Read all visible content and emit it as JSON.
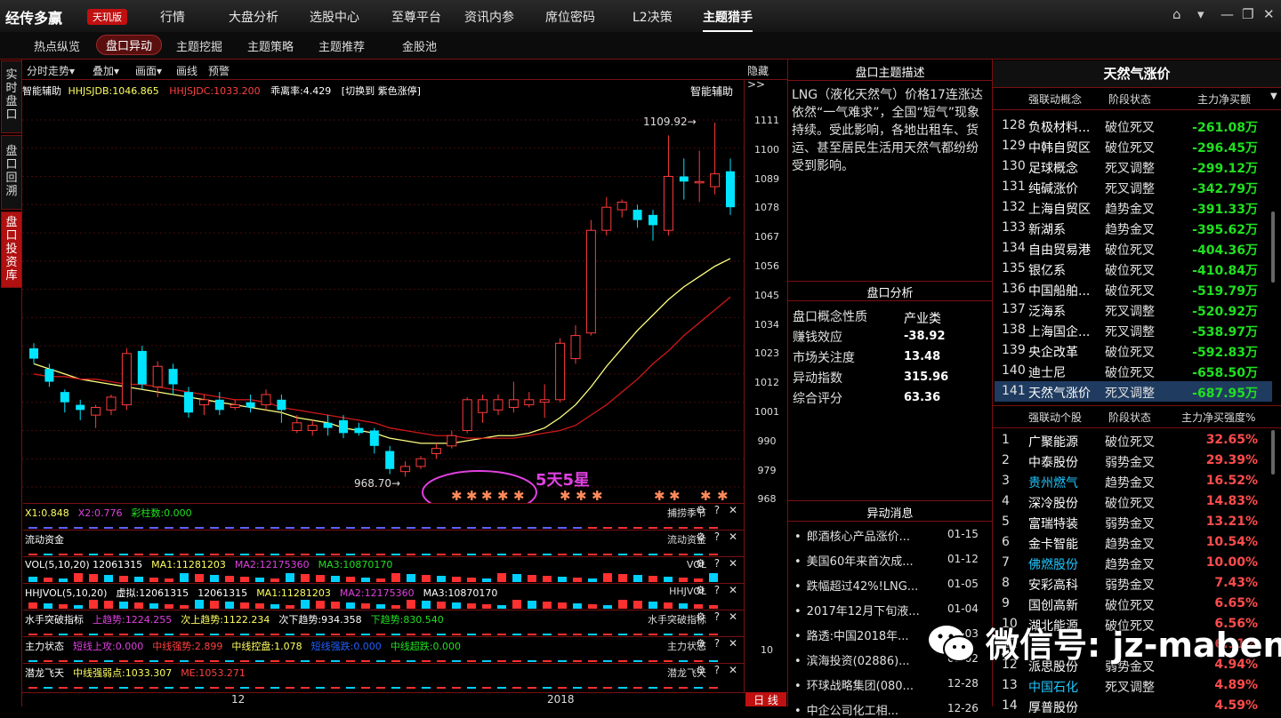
{
  "app": {
    "logo": "经传多赢",
    "edition": "天玑版"
  },
  "menu": [
    "行情",
    "大盘分析",
    "选股中心",
    "至尊平台",
    "资讯内参",
    "席位密码",
    "L2决策",
    "主题猎手"
  ],
  "menu_active": "主题猎手",
  "window_controls": [
    "⌂",
    "▾",
    "—",
    "❐",
    "✕"
  ],
  "subtabs": [
    "热点纵览",
    "盘口异动",
    "主题挖掘",
    "主题策略",
    "主题推荐",
    "金股池"
  ],
  "subtab_active": "盘口异动",
  "left_tabs": [
    {
      "label": "实时盘口"
    },
    {
      "label": "盘口回溯"
    },
    {
      "label": "盘口投资库"
    }
  ],
  "toolbar": {
    "items": [
      "分时走势▾",
      "叠加▾",
      "画面▾",
      "画线",
      "预警"
    ],
    "hide": "隐藏>>"
  },
  "chart": {
    "header_left": "智能辅助",
    "hhjsjdb": "HHJSJDB:1046.865",
    "hhjsjdc": "HHJSJDC:1033.200",
    "deviation": "乖离率:4.429",
    "switch": "[切换到 紫色涨停]",
    "header_right": "智能辅助",
    "high_label": "1109.92→",
    "low_label": "968.70→",
    "annotation": "5天5星",
    "x_labels": [
      "12",
      "2018"
    ],
    "period": "日 线",
    "y_ticks": [
      "1111",
      "1100",
      "1089",
      "1078",
      "1067",
      "1056",
      "1045",
      "1034",
      "1023",
      "1012",
      "1001",
      "990",
      "979",
      "968"
    ]
  },
  "chart_data": {
    "type": "candlestick",
    "ylim": [
      968,
      1111
    ],
    "candles": [
      {
        "o": 1022,
        "c": 1018,
        "h": 1024,
        "l": 1016
      },
      {
        "o": 1014,
        "c": 1009,
        "h": 1016,
        "l": 1007
      },
      {
        "o": 1005,
        "c": 1001,
        "h": 1006,
        "l": 997
      },
      {
        "o": 1000,
        "c": 998,
        "h": 1002,
        "l": 994
      },
      {
        "o": 996,
        "c": 999,
        "h": 1000,
        "l": 991
      },
      {
        "o": 998,
        "c": 1003,
        "h": 1004,
        "l": 996
      },
      {
        "o": 1000,
        "c": 1020,
        "h": 1022,
        "l": 998
      },
      {
        "o": 1021,
        "c": 1008,
        "h": 1023,
        "l": 1006
      },
      {
        "o": 1007,
        "c": 1015,
        "h": 1017,
        "l": 1003
      },
      {
        "o": 1014,
        "c": 1008,
        "h": 1016,
        "l": 1004
      },
      {
        "o": 1005,
        "c": 997,
        "h": 1007,
        "l": 995
      },
      {
        "o": 1000,
        "c": 1002,
        "h": 1004,
        "l": 996
      },
      {
        "o": 1002,
        "c": 998,
        "h": 1005,
        "l": 996
      },
      {
        "o": 999,
        "c": 1000,
        "h": 1002,
        "l": 998
      },
      {
        "o": 1001,
        "c": 999,
        "h": 1004,
        "l": 997
      },
      {
        "o": 1000,
        "c": 1004,
        "h": 1006,
        "l": 998
      },
      {
        "o": 1002,
        "c": 998,
        "h": 1004,
        "l": 993
      },
      {
        "o": 990,
        "c": 993,
        "h": 996,
        "l": 989
      },
      {
        "o": 990,
        "c": 992,
        "h": 994,
        "l": 988
      },
      {
        "o": 993,
        "c": 991,
        "h": 996,
        "l": 988
      },
      {
        "o": 994,
        "c": 989,
        "h": 996,
        "l": 987
      },
      {
        "o": 991,
        "c": 989,
        "h": 993,
        "l": 988
      },
      {
        "o": 990,
        "c": 984,
        "h": 991,
        "l": 981
      },
      {
        "o": 982,
        "c": 975,
        "h": 984,
        "l": 973
      },
      {
        "o": 974,
        "c": 976,
        "h": 978,
        "l": 972
      },
      {
        "o": 976,
        "c": 979,
        "h": 980,
        "l": 975
      },
      {
        "o": 981,
        "c": 983,
        "h": 985,
        "l": 979
      },
      {
        "o": 984,
        "c": 988,
        "h": 990,
        "l": 983
      },
      {
        "o": 990,
        "c": 1002,
        "h": 1003,
        "l": 989
      },
      {
        "o": 997,
        "c": 1002,
        "h": 1004,
        "l": 993
      },
      {
        "o": 998,
        "c": 1002,
        "h": 1004,
        "l": 996
      },
      {
        "o": 999,
        "c": 1002,
        "h": 1009,
        "l": 997
      },
      {
        "o": 1000,
        "c": 1002,
        "h": 1005,
        "l": 999
      },
      {
        "o": 1001,
        "c": 1002,
        "h": 1008,
        "l": 995
      },
      {
        "o": 1002,
        "c": 1024,
        "h": 1026,
        "l": 1001
      },
      {
        "o": 1018,
        "c": 1027,
        "h": 1031,
        "l": 1016
      },
      {
        "o": 1028,
        "c": 1068,
        "h": 1072,
        "l": 1027
      },
      {
        "o": 1068,
        "c": 1077,
        "h": 1081,
        "l": 1066
      },
      {
        "o": 1076,
        "c": 1079,
        "h": 1080,
        "l": 1073
      },
      {
        "o": 1076,
        "c": 1072,
        "h": 1078,
        "l": 1069
      },
      {
        "o": 1074,
        "c": 1070,
        "h": 1076,
        "l": 1064
      },
      {
        "o": 1068,
        "c": 1089,
        "h": 1105,
        "l": 1066
      },
      {
        "o": 1089,
        "c": 1087,
        "h": 1096,
        "l": 1080
      },
      {
        "o": 1087,
        "c": 1087,
        "h": 1099,
        "l": 1079
      },
      {
        "o": 1085,
        "c": 1090,
        "h": 1109.92,
        "l": 1082
      },
      {
        "o": 1091,
        "c": 1077,
        "h": 1096,
        "l": 1074
      }
    ],
    "ma_yellow": [
      1016,
      1014,
      1012,
      1010,
      1009,
      1008,
      1007,
      1006,
      1005,
      1004,
      1003,
      1002,
      1001,
      1000,
      999,
      998,
      997,
      995,
      994,
      993,
      991,
      990,
      989,
      987,
      986,
      985,
      985,
      985,
      986,
      987,
      988,
      988,
      989,
      991,
      995,
      1000,
      1007,
      1015,
      1022,
      1029,
      1035,
      1041,
      1046,
      1050,
      1054,
      1057
    ],
    "ma_red": [
      1012,
      1011,
      1011,
      1010,
      1010,
      1009,
      1008,
      1008,
      1007,
      1006,
      1005,
      1004,
      1003,
      1002,
      1002,
      1001,
      999,
      998,
      997,
      996,
      995,
      994,
      993,
      991,
      990,
      989,
      988,
      988,
      987,
      987,
      987,
      987,
      988,
      989,
      990,
      992,
      996,
      1000,
      1005,
      1010,
      1016,
      1021,
      1027,
      1032,
      1037,
      1042
    ],
    "star_groups": [
      5,
      3,
      2,
      2
    ]
  },
  "indicators": [
    {
      "name": "捕捞季节",
      "parts": [
        {
          "t": "X1:0.848",
          "c": "#ffff60"
        },
        {
          "t": "X2:0.776",
          "c": "#e040e0"
        },
        {
          "t": "彩柱数:0.000",
          "c": "#20e020"
        }
      ]
    },
    {
      "name": "流动资金",
      "parts": []
    },
    {
      "name": "VOL",
      "parts": [
        {
          "t": "VOL(5,10,20) 12061315",
          "c": "#fff"
        },
        {
          "t": "MA1:11281203",
          "c": "#ffff60"
        },
        {
          "t": "MA2:12175360",
          "c": "#e040e0"
        },
        {
          "t": "MA3:10870170",
          "c": "#20e020"
        }
      ]
    },
    {
      "name": "HHJVOL",
      "parts": [
        {
          "t": "HHJVOL(5,10,20)",
          "c": "#fff"
        },
        {
          "t": "虚拟:12061315",
          "c": "#fff"
        },
        {
          "t": "12061315",
          "c": "#fff"
        },
        {
          "t": "MA1:11281203",
          "c": "#ffff60"
        },
        {
          "t": "MA2:12175360",
          "c": "#e040e0"
        },
        {
          "t": "MA3:10870170",
          "c": "#fff"
        }
      ]
    },
    {
      "name": "水手突破指标",
      "parts": [
        {
          "t": "水手突破指标",
          "c": "#fff"
        },
        {
          "t": "上趋势:1224.255",
          "c": "#e040e0"
        },
        {
          "t": "次上趋势:1122.234",
          "c": "#ffff60"
        },
        {
          "t": "次下趋势:934.358",
          "c": "#fff"
        },
        {
          "t": "下趋势:830.540",
          "c": "#20e020"
        }
      ]
    },
    {
      "name": "主力状态",
      "parts": [
        {
          "t": "主力状态",
          "c": "#fff"
        },
        {
          "t": "短线上攻:0.000",
          "c": "#e040e0"
        },
        {
          "t": "中线强势:2.899",
          "c": "#ff4040"
        },
        {
          "t": "中线控盘:1.078",
          "c": "#ffff60"
        },
        {
          "t": "短线强跌:0.000",
          "c": "#2060ff"
        },
        {
          "t": "中线超跌:0.000",
          "c": "#20e020"
        }
      ]
    },
    {
      "name": "潜龙飞天",
      "parts": [
        {
          "t": "潜龙飞天",
          "c": "#fff"
        },
        {
          "t": "中线强弱点:1033.307",
          "c": "#ffff60"
        },
        {
          "t": "ME:1053.271",
          "c": "#ff4040"
        }
      ]
    }
  ],
  "indicator_icons": "⚙ ? ✕",
  "main_state_value": "10",
  "topic_desc": {
    "title": "盘口主题描述",
    "text": "LNG（液化天然气）价格17连涨达依然“一气难求”，全国“短气”现象持续。受此影响，各地出租车、货运、甚至居民生活用天然气都纷纷受到影响。"
  },
  "analysis": {
    "title": "盘口分析",
    "rows": [
      {
        "k": "盘口概念性质",
        "v": "产业类"
      },
      {
        "k": "赚钱效应",
        "v": "-38.92"
      },
      {
        "k": "市场关注度",
        "v": "13.48"
      },
      {
        "k": "异动指数",
        "v": "315.96"
      },
      {
        "k": "综合评分",
        "v": "63.36"
      }
    ]
  },
  "news": {
    "title": "异动消息",
    "items": [
      {
        "t": "郎酒核心产品涨价...",
        "d": "01-15"
      },
      {
        "t": "美国60年来首次成...",
        "d": "01-12"
      },
      {
        "t": "跌幅超过42%!LNG...",
        "d": "01-05"
      },
      {
        "t": "2017年12月下旬液...",
        "d": "01-04"
      },
      {
        "t": "路透:中国2018年...",
        "d": "01-03"
      },
      {
        "t": "滨海投资(02886)...",
        "d": "01-02"
      },
      {
        "t": "环球战略集团(080...",
        "d": "12-28"
      },
      {
        "t": "中企公司化工相...",
        "d": "12-26"
      }
    ]
  },
  "right": {
    "title": "天然气涨价",
    "concept_headers": [
      "强联动概念",
      "阶段状态",
      "主力净买额"
    ],
    "concepts": [
      {
        "n": "128",
        "name": "负极材料...",
        "st": "破位死叉",
        "v": "-261.08万"
      },
      {
        "n": "129",
        "name": "中韩自贸区",
        "st": "破位死叉",
        "v": "-296.45万"
      },
      {
        "n": "130",
        "name": "足球概念",
        "st": "死叉调整",
        "v": "-299.12万"
      },
      {
        "n": "131",
        "name": "纯碱涨价",
        "st": "死叉调整",
        "v": "-342.79万"
      },
      {
        "n": "132",
        "name": "上海自贸区",
        "st": "趋势金叉",
        "v": "-391.33万"
      },
      {
        "n": "133",
        "name": "新湖系",
        "st": "趋势金叉",
        "v": "-395.62万"
      },
      {
        "n": "134",
        "name": "自由贸易港",
        "st": "破位死叉",
        "v": "-404.36万"
      },
      {
        "n": "135",
        "name": "银亿系",
        "st": "破位死叉",
        "v": "-410.84万"
      },
      {
        "n": "136",
        "name": "中国船舶...",
        "st": "破位死叉",
        "v": "-519.79万"
      },
      {
        "n": "137",
        "name": "泛海系",
        "st": "死叉调整",
        "v": "-520.92万"
      },
      {
        "n": "138",
        "name": "上海国企...",
        "st": "死叉调整",
        "v": "-538.97万"
      },
      {
        "n": "139",
        "name": "央企改革",
        "st": "破位死叉",
        "v": "-592.83万"
      },
      {
        "n": "140",
        "name": "迪士尼",
        "st": "破位死叉",
        "v": "-658.50万"
      },
      {
        "n": "141",
        "name": "天然气涨价",
        "st": "死叉调整",
        "v": "-687.95万"
      }
    ],
    "stock_headers": [
      "强联动个股",
      "阶段状态",
      "主力净买强度%"
    ],
    "stocks": [
      {
        "n": "1",
        "name": "广聚能源",
        "st": "破位死叉",
        "v": "32.65%",
        "cy": false
      },
      {
        "n": "2",
        "name": "中泰股份",
        "st": "弱势金叉",
        "v": "29.39%",
        "cy": false
      },
      {
        "n": "3",
        "name": "贵州燃气",
        "st": "趋势金叉",
        "v": "16.52%",
        "cy": true
      },
      {
        "n": "4",
        "name": "深冷股份",
        "st": "破位死叉",
        "v": "14.83%",
        "cy": false
      },
      {
        "n": "5",
        "name": "富瑞特装",
        "st": "弱势金叉",
        "v": "13.21%",
        "cy": false
      },
      {
        "n": "6",
        "name": "金卡智能",
        "st": "趋势金叉",
        "v": "10.54%",
        "cy": false
      },
      {
        "n": "7",
        "name": "佛燃股份",
        "st": "趋势金叉",
        "v": "10.00%",
        "cy": true
      },
      {
        "n": "8",
        "name": "安彩高科",
        "st": "弱势金叉",
        "v": "7.43%",
        "cy": false
      },
      {
        "n": "9",
        "name": "国创高新",
        "st": "破位死叉",
        "v": "6.65%",
        "cy": false
      },
      {
        "n": "10",
        "name": "湖北能源",
        "st": "破位死叉",
        "v": "6.56%",
        "cy": false
      },
      {
        "n": "11",
        "name": "",
        "st": "",
        "v": "6.11%",
        "cy": false
      },
      {
        "n": "12",
        "name": "派思股份",
        "st": "弱势金叉",
        "v": "4.94%",
        "cy": false
      },
      {
        "n": "13",
        "name": "中国石化",
        "st": "死叉调整",
        "v": "4.89%",
        "cy": true
      },
      {
        "n": "14",
        "name": "厚普股份",
        "st": "",
        "v": "4.59%",
        "cy": false
      }
    ]
  },
  "watermark": "微信号: jz-maben",
  "colors": {
    "up": "#ff3b3b",
    "down": "#00e5ff",
    "frame": "#7a1010",
    "ma_yellow": "#ffff80",
    "ma_red": "#d01818"
  }
}
